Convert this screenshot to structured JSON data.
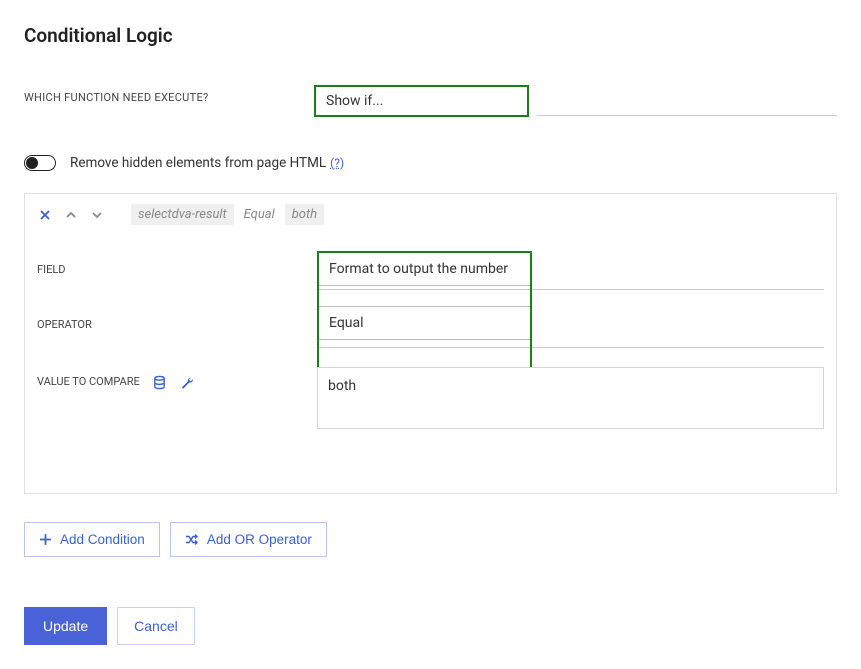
{
  "title": "Conditional Logic",
  "function": {
    "label": "WHICH FUNCTION NEED EXECUTE?",
    "value": "Show if..."
  },
  "toggle": {
    "label": "Remove hidden elements from page HTML",
    "help": "(?)"
  },
  "condition_header": {
    "pill_field": "selectdva-result",
    "pill_op": "Equal",
    "pill_val": "both"
  },
  "condition": {
    "field_label": "FIELD",
    "field_value": "Format to output the number",
    "operator_label": "OPERATOR",
    "operator_value": "Equal",
    "value_label": "VALUE TO COMPARE",
    "value_value": "both"
  },
  "buttons": {
    "add_condition": "Add Condition",
    "add_or": "Add OR Operator",
    "update": "Update",
    "cancel": "Cancel"
  }
}
